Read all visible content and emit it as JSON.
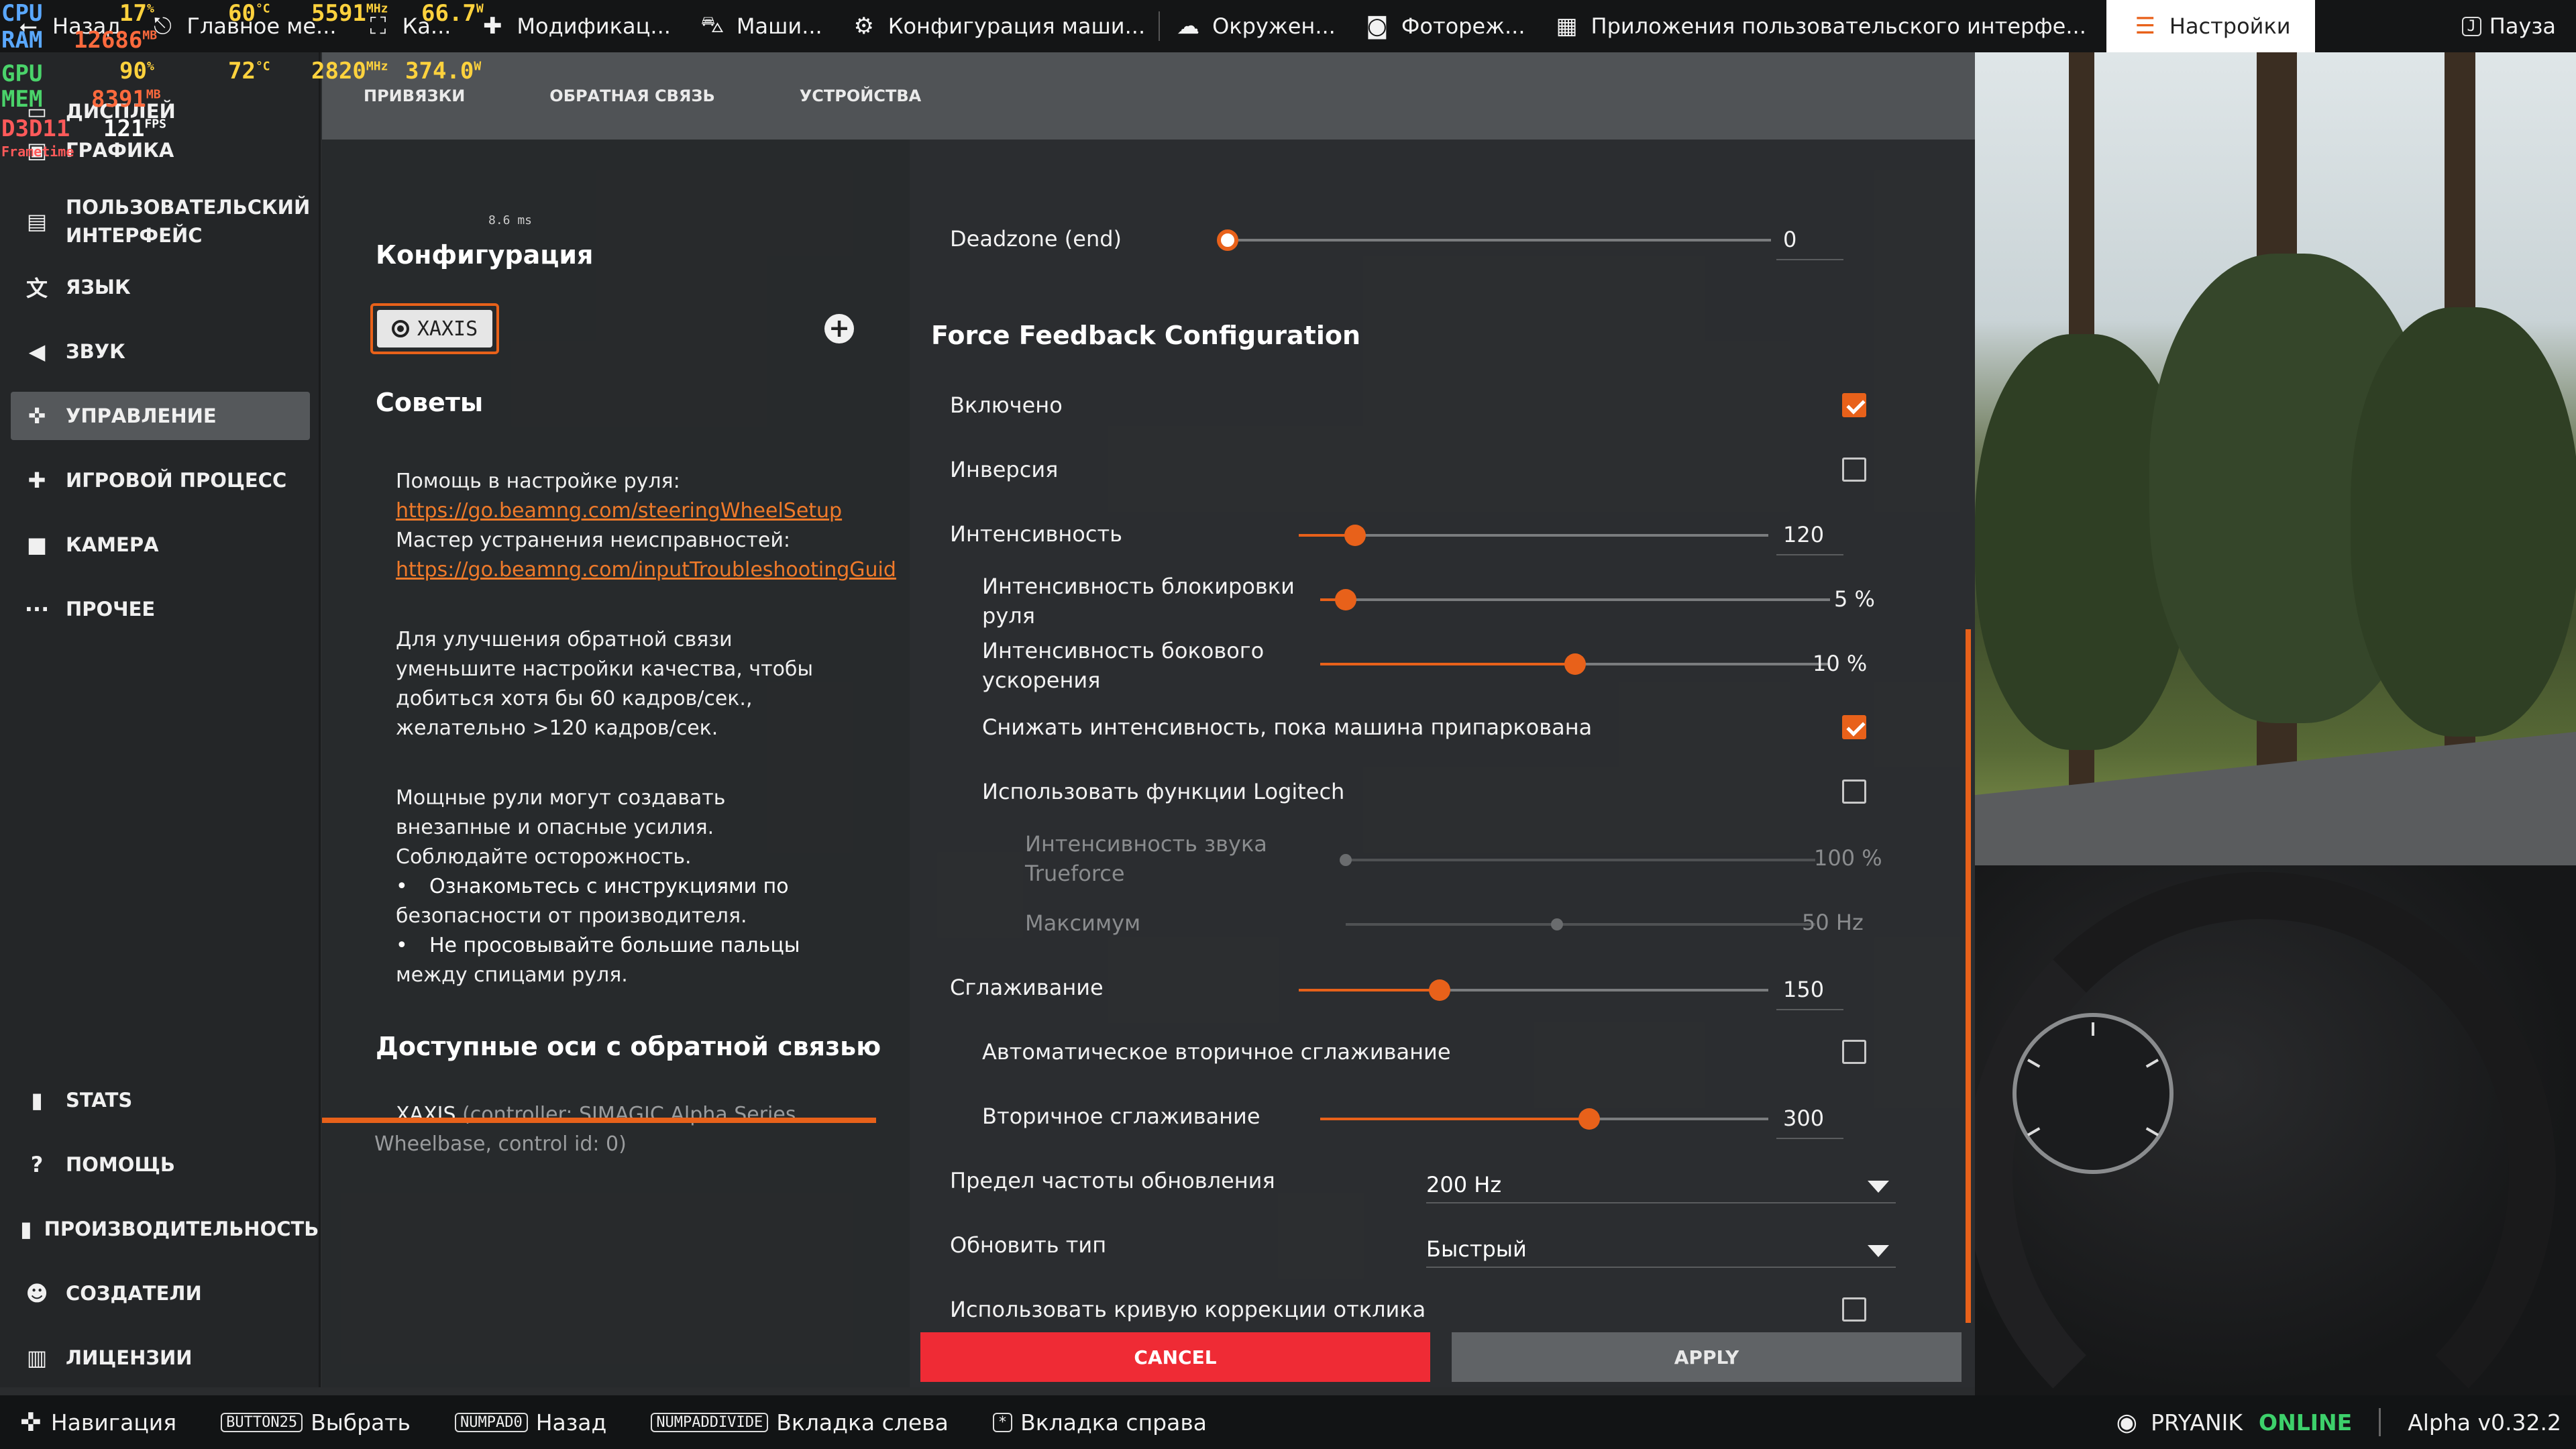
{
  "hud": {
    "cpu_label": "CPU",
    "cpu_load": "17",
    "cpu_load_unit": "%",
    "cpu_temp": "60",
    "cpu_temp_unit": "°C",
    "cpu_clock": "5591",
    "cpu_clock_unit": "MHz",
    "cpu_power": "66.7",
    "cpu_power_unit": "W",
    "ram_label": "RAM",
    "ram_value": "12686",
    "ram_unit": "MB",
    "gpu_label": "GPU",
    "gpu_load": "90",
    "gpu_load_unit": "%",
    "gpu_temp": "72",
    "gpu_temp_unit": "°C",
    "gpu_clock": "2820",
    "gpu_clock_unit": "MHz",
    "gpu_power": "374.0",
    "gpu_power_unit": "W",
    "mem_label": "MEM",
    "mem_value": "8391",
    "mem_unit": "MB",
    "api_label": "D3D11",
    "fps_value": "121",
    "fps_unit": "FPS",
    "frametime_label": "Frametime",
    "frametime_value": "8.6 ms"
  },
  "topbar": {
    "back": "Назад",
    "items": [
      "Главное ме...",
      "Ка...",
      "Модификац...",
      "Маши...",
      "Конфигурация маши...",
      "Окружен...",
      "Фотореж...",
      "Приложения пользовательского интерфе..."
    ],
    "active": "Настройки",
    "pause_key": "J",
    "pause": "Пауза"
  },
  "sidebar": {
    "items": [
      "Дисплей",
      "Графика",
      "Пользовательский интерфейс",
      "Язык",
      "Звук",
      "Управление",
      "Игровой процесс",
      "Камера",
      "Прочее"
    ],
    "bottom": [
      "Stats",
      "Помощь",
      "Производительность",
      "Создатели",
      "Лицензии"
    ]
  },
  "subtabs": [
    "Привязки",
    "Обратная связь",
    "Устройства"
  ],
  "config": {
    "title": "Конфигурация",
    "device": "XAXIS",
    "tips_title": "Советы",
    "tips": [
      "Помощь в настройке руля:",
      "https://go.beamng.com/steeringWheelSetup",
      "Мастер устранения неисправностей:",
      "https://go.beamng.com/inputTroubleshootingGuid",
      "Для улучшения обратной связи",
      "уменьшите настройки качества, чтобы",
      "добиться хотя бы 60 кадров/сек.,",
      "желательно >120 кадров/сек.",
      "Мощные рули могут создавать",
      "внезапные и опасные усилия.",
      "Соблюдайте осторожность.",
      "Ознакомьтесь с инструкциями по",
      "безопасности от производителя.",
      "Не просовывайте большие пальцы",
      "между спицами руля."
    ],
    "axes_title": "Доступные оси с обратной связью",
    "axis_name": "XAXIS",
    "axis_desc_1": "(controller: SIMAGIC Alpha Series",
    "axis_desc_2": "Wheelbase, control id: 0)"
  },
  "ffb": {
    "deadzone_label": "Deadzone (end)",
    "deadzone_value": "0",
    "deadzone_level": 0,
    "title": "Force Feedback Configuration",
    "enabled_label": "Включено",
    "enabled": true,
    "inverse_label": "Инверсия",
    "inverse": false,
    "intensity_label": "Интенсивность",
    "intensity_value": "120",
    "intensity_level": 0.12,
    "lock_label_1": "Интенсивность блокировки",
    "lock_label_2": "руля",
    "lock_value": "5 %",
    "lock_level": 0.05,
    "lateral_label_1": "Интенсивность бокового",
    "lateral_label_2": "ускорения",
    "lateral_value": "10 %",
    "lateral_level": 0.5,
    "parked_label": "Снижать интенсивность, пока машина припаркована",
    "parked": true,
    "logitech_label": "Использовать функции Logitech",
    "logitech": false,
    "trueforce_label_1": "Интенсивность звука",
    "trueforce_label_2": "Trueforce",
    "trueforce_value": "100 %",
    "trueforce_level": 0.0,
    "max_label": "Максимум",
    "max_value": "50 Hz",
    "max_level": 0.45,
    "smoothing_label": "Сглаживание",
    "smoothing_value": "150",
    "smoothing_level": 0.3,
    "auto_smoothing_label": "Автоматическое вторичное сглаживание",
    "auto_smoothing": false,
    "secondary_label": "Вторичное сглаживание",
    "secondary_value": "300",
    "secondary_level": 0.6,
    "rate_label": "Предел частоты обновления",
    "rate_value": "200 Hz",
    "update_label": "Обновить тип",
    "update_value": "Быстрый",
    "curve_label": "Использовать кривую коррекции отклика",
    "curve": false,
    "cancel": "Cancel",
    "apply": "Apply"
  },
  "bottombar": {
    "nav": "Навигация",
    "select_key": "BUTTON25",
    "select": "Выбрать",
    "back_key": "NUMPAD0",
    "back": "Назад",
    "tab_left_key": "NUMPADDIVIDE",
    "tab_left": "Вкладка слева",
    "tab_right_key": "*",
    "tab_right": "Вкладка справа",
    "user": "PRYANIK",
    "status": "ONLINE",
    "version": "Alpha v0.32.2"
  },
  "colors": {
    "accent": "#e8611a",
    "cancel": "#ef2b35",
    "online": "#3dd16b"
  }
}
